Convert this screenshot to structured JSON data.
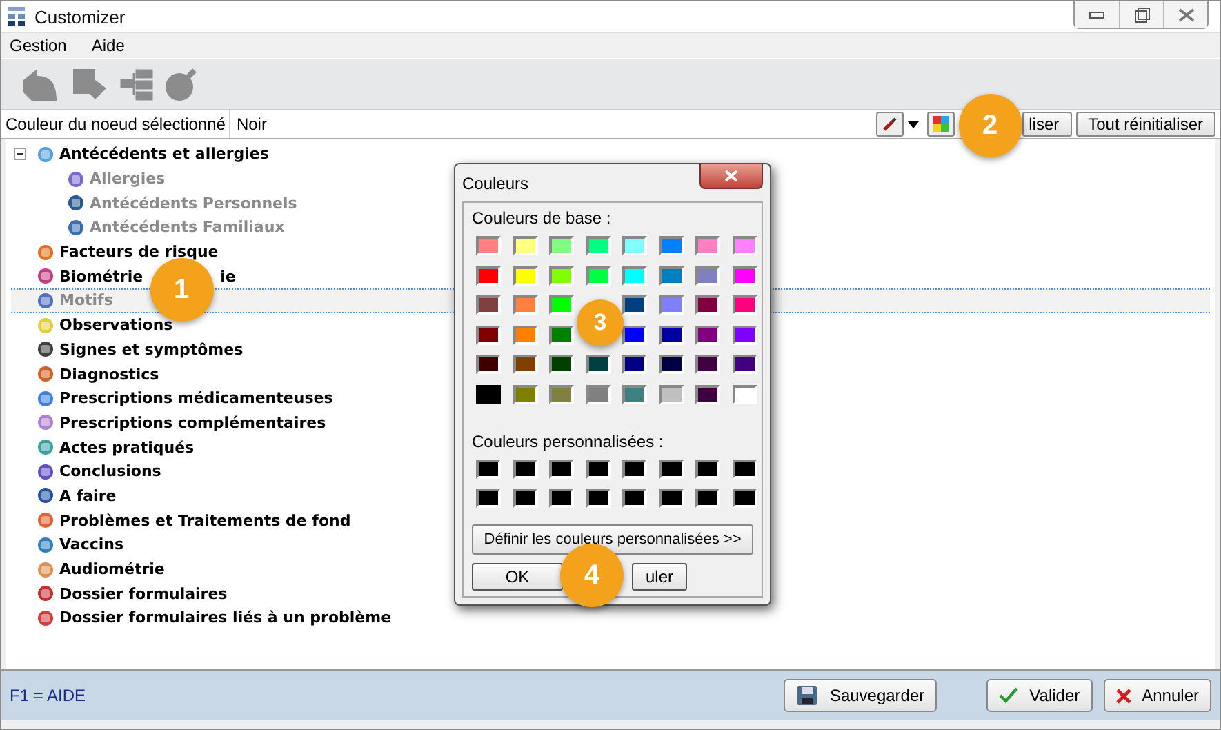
{
  "window": {
    "title": "Customizer"
  },
  "menu": [
    "Gestion",
    "Aide"
  ],
  "node_color": {
    "label": "Couleur du noeud sélectionné",
    "value": "Noir"
  },
  "reset_button": "liser",
  "reset_all_button": "Tout réinitialiser",
  "tree": [
    {
      "label": "Antécédents et allergies",
      "expanded": true,
      "disabled": false,
      "selected": false,
      "children": [
        {
          "label": "Allergies",
          "disabled": true,
          "selected": false
        },
        {
          "label": "Antécédents Personnels",
          "disabled": true,
          "selected": false
        },
        {
          "label": "Antécédents Familiaux",
          "disabled": true,
          "selected": false
        }
      ]
    },
    {
      "label": "Facteurs de risque",
      "disabled": false,
      "selected": false
    },
    {
      "label": "Biométrie",
      "label_tail": "ie",
      "disabled": false,
      "selected": false
    },
    {
      "label": "Motifs",
      "disabled": true,
      "selected": true
    },
    {
      "label": "Observations",
      "disabled": false,
      "selected": false
    },
    {
      "label": "Signes et symptômes",
      "disabled": false,
      "selected": false
    },
    {
      "label": "Diagnostics",
      "disabled": false,
      "selected": false
    },
    {
      "label": "Prescriptions médicamenteuses",
      "disabled": false,
      "selected": false
    },
    {
      "label": "Prescriptions complémentaires",
      "disabled": false,
      "selected": false
    },
    {
      "label": "Actes pratiqués",
      "disabled": false,
      "selected": false
    },
    {
      "label": "Conclusions",
      "disabled": false,
      "selected": false
    },
    {
      "label": "A faire",
      "disabled": false,
      "selected": false
    },
    {
      "label": "Problèmes et Traitements de fond",
      "disabled": false,
      "selected": false
    },
    {
      "label": "Vaccins",
      "disabled": false,
      "selected": false
    },
    {
      "label": "Audiométrie",
      "disabled": false,
      "selected": false
    },
    {
      "label": "Dossier formulaires",
      "disabled": false,
      "selected": false
    },
    {
      "label": "Dossier formulaires liés à un problème",
      "disabled": false,
      "selected": false
    }
  ],
  "status_bar": {
    "help": "F1 = AIDE",
    "buttons": [
      {
        "label": "Sauvegarder",
        "kind": "save"
      },
      {
        "label": "Valider",
        "kind": "ok"
      },
      {
        "label": "Annuler",
        "kind": "cancel"
      }
    ]
  },
  "dialog": {
    "title": "Couleurs",
    "base_label": "Couleurs de base :",
    "custom_label": "Couleurs personnalisées :",
    "base_colors": [
      {
        "color": "#ff8080",
        "selected": false
      },
      {
        "color": "#ffff80",
        "selected": false
      },
      {
        "color": "#80ff80",
        "selected": false
      },
      {
        "color": "#00ff80",
        "selected": false
      },
      {
        "color": "#80ffff",
        "selected": false
      },
      {
        "color": "#0080ff",
        "selected": false
      },
      {
        "color": "#ff80c0",
        "selected": false
      },
      {
        "color": "#ff80ff",
        "selected": false
      },
      {
        "color": "#ff0000",
        "selected": false
      },
      {
        "color": "#ffff00",
        "selected": false
      },
      {
        "color": "#80ff00",
        "selected": false
      },
      {
        "color": "#00ff40",
        "selected": false
      },
      {
        "color": "#00ffff",
        "selected": false
      },
      {
        "color": "#0080c0",
        "selected": false
      },
      {
        "color": "#8080c0",
        "selected": false
      },
      {
        "color": "#ff00ff",
        "selected": false
      },
      {
        "color": "#804040",
        "selected": false
      },
      {
        "color": "#ff8040",
        "selected": false
      },
      {
        "color": "#00ff00",
        "selected": false
      },
      {
        "kind": "hidden"
      },
      {
        "color": "#004080",
        "selected": false
      },
      {
        "color": "#8080ff",
        "selected": false
      },
      {
        "color": "#800040",
        "selected": false
      },
      {
        "color": "#ff0080",
        "selected": false
      },
      {
        "color": "#800000",
        "selected": false
      },
      {
        "color": "#ff8000",
        "selected": false
      },
      {
        "color": "#008000",
        "selected": false
      },
      {
        "kind": "hidden"
      },
      {
        "color": "#0000ff",
        "selected": false
      },
      {
        "color": "#0000a0",
        "selected": false
      },
      {
        "color": "#800080",
        "selected": false
      },
      {
        "color": "#8000ff",
        "selected": false
      },
      {
        "color": "#400000",
        "selected": false
      },
      {
        "color": "#804000",
        "selected": false
      },
      {
        "color": "#004000",
        "selected": false
      },
      {
        "color": "#004040",
        "selected": false
      },
      {
        "color": "#000080",
        "selected": false
      },
      {
        "color": "#000040",
        "selected": false
      },
      {
        "color": "#400040",
        "selected": false
      },
      {
        "color": "#400080",
        "selected": false
      },
      {
        "color": "#000000",
        "selected": true
      },
      {
        "color": "#808000",
        "selected": false
      },
      {
        "color": "#808040",
        "selected": false
      },
      {
        "color": "#808080",
        "selected": false
      },
      {
        "color": "#408080",
        "selected": false
      },
      {
        "color": "#c0c0c0",
        "selected": false
      },
      {
        "color": "#400040",
        "selected": false
      },
      {
        "color": "#ffffff",
        "selected": false
      }
    ],
    "custom_colors": [
      {
        "color": "#000000"
      },
      {
        "color": "#000000"
      },
      {
        "color": "#000000"
      },
      {
        "color": "#000000"
      },
      {
        "color": "#000000"
      },
      {
        "color": "#000000"
      },
      {
        "color": "#000000"
      },
      {
        "color": "#000000"
      },
      {
        "color": "#000000"
      },
      {
        "color": "#000000"
      },
      {
        "color": "#000000"
      },
      {
        "color": "#000000"
      },
      {
        "color": "#000000"
      },
      {
        "color": "#000000"
      },
      {
        "color": "#000000"
      },
      {
        "color": "#000000"
      }
    ],
    "define_button": "Définir les couleurs personnalisées >>",
    "ok_button": "OK",
    "cancel_button": "uler"
  },
  "callouts": [
    "1",
    "2",
    "3",
    "4"
  ]
}
